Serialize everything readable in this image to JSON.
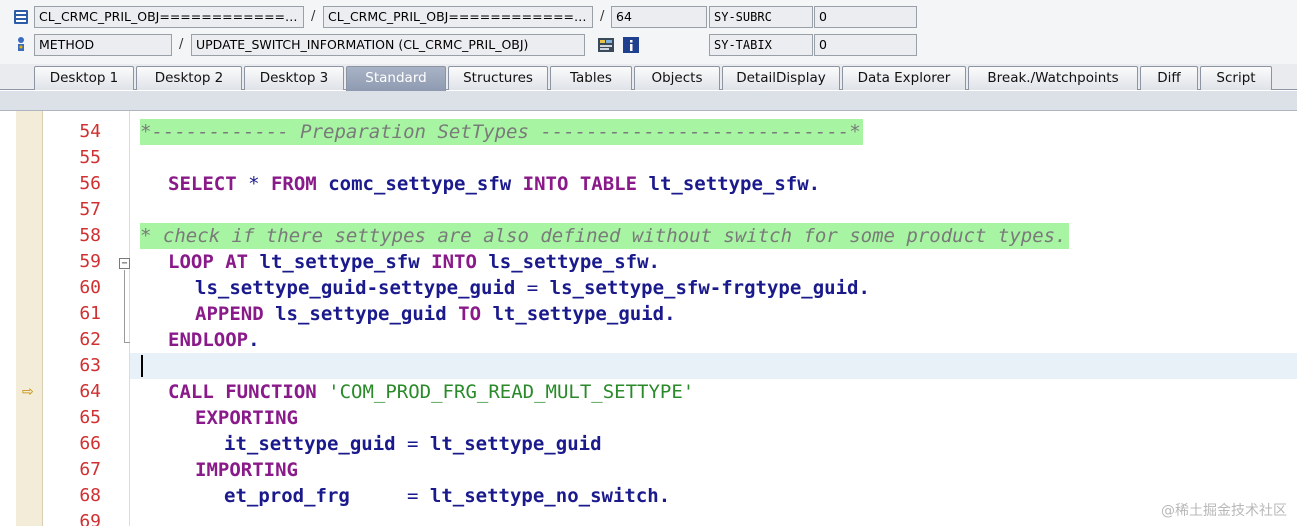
{
  "header": {
    "row1": {
      "program": "CL_CRMC_PRIL_OBJ=============...",
      "include": "CL_CRMC_PRIL_OBJ=============...",
      "line": "64",
      "sysvar_name": "SY-SUBRC",
      "sysvar_value": "0"
    },
    "row2": {
      "event_type": "METHOD",
      "event_name": "UPDATE_SWITCH_INFORMATION (CL_CRMC_PRIL_OBJ)",
      "sysvar_name": "SY-TABIX",
      "sysvar_value": "0"
    },
    "separator": "/"
  },
  "tabs": [
    {
      "label": "Desktop 1",
      "active": false
    },
    {
      "label": "Desktop 2",
      "active": false
    },
    {
      "label": "Desktop 3",
      "active": false
    },
    {
      "label": "Standard",
      "active": true
    },
    {
      "label": "Structures",
      "active": false
    },
    {
      "label": "Tables",
      "active": false
    },
    {
      "label": "Objects",
      "active": false
    },
    {
      "label": "DetailDisplay",
      "active": false
    },
    {
      "label": "Data Explorer",
      "active": false
    },
    {
      "label": "Break./Watchpoints",
      "active": false
    },
    {
      "label": "Diff",
      "active": false
    },
    {
      "label": "Script",
      "active": false
    }
  ],
  "code": {
    "lines": [
      {
        "n": "54"
      },
      {
        "n": "55"
      },
      {
        "n": "56"
      },
      {
        "n": "57"
      },
      {
        "n": "58"
      },
      {
        "n": "59"
      },
      {
        "n": "60"
      },
      {
        "n": "61"
      },
      {
        "n": "62"
      },
      {
        "n": "63"
      },
      {
        "n": "64"
      },
      {
        "n": "65"
      },
      {
        "n": "66"
      },
      {
        "n": "67"
      },
      {
        "n": "68"
      },
      {
        "n": "69"
      }
    ],
    "t": {
      "l54": "*------------ Preparation SetTypes ---------------------------*",
      "l56_kw1": "SELECT",
      "l56_a": " * ",
      "l56_kw2": "FROM",
      "l56_id1": "comc_settype_sfw",
      "l56_kw3": "INTO TABLE",
      "l56_id2": "lt_settype_sfw",
      "l56_end": ".",
      "l58": "* check if there settypes are also defined without switch for some product types.",
      "l59_kw1": "LOOP AT",
      "l59_id1": "lt_settype_sfw",
      "l59_kw2": "INTO",
      "l59_id2": "ls_settype_sfw",
      "l59_end": ".",
      "l60_id1": "ls_settype_guid-settype_guid",
      "l60_op": " = ",
      "l60_id2": "ls_settype_sfw-frgtype_guid",
      "l60_end": ".",
      "l61_kw1": "APPEND",
      "l61_id1": "ls_settype_guid",
      "l61_kw2": "TO",
      "l61_id2": "lt_settype_guid",
      "l61_end": ".",
      "l62_kw": "ENDLOOP",
      "l62_end": ".",
      "l64_kw": "CALL FUNCTION",
      "l64_str": "'COM_PROD_FRG_READ_MULT_SETTYPE'",
      "l65_kw": "EXPORTING",
      "l66_id1": "it_settype_guid",
      "l66_op": " = ",
      "l66_id2": "lt_settype_guid",
      "l67_kw": "IMPORTING",
      "l68_id1": "et_prod_frg",
      "l68_op": "     = ",
      "l68_id2": "lt_settype_no_switch",
      "l68_end": "."
    }
  },
  "watermark": "@稀土掘金技术社区",
  "colors": {
    "keyword": "#8a1a8a",
    "identifier": "#1a1a8c",
    "string": "#2a8a2a",
    "comment_bg": "#a7f5a3",
    "line_number": "#d03030",
    "active_tab": "#9aa5bb"
  },
  "icons": {
    "program": "program-list-icon",
    "event": "method-person-icon",
    "source_code": "source-code-icon",
    "info": "info-icon",
    "execution_pointer": "execution-arrow-icon"
  }
}
